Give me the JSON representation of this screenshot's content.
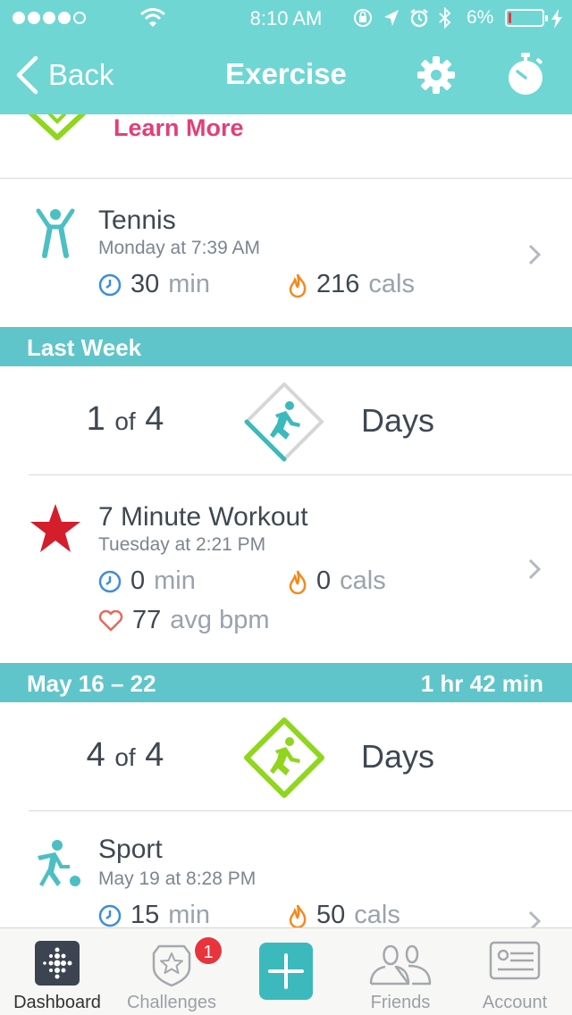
{
  "status_bar": {
    "time": "8:10 AM",
    "battery_percent": "6%",
    "battery_level": 0.06
  },
  "nav": {
    "back_label": "Back",
    "title": "Exercise"
  },
  "learn_more": {
    "link": "Learn More"
  },
  "sections": [
    {
      "items": [
        {
          "title": "Tennis",
          "subtitle": "Monday at 7:39 AM",
          "duration": "30",
          "duration_unit": "min",
          "calories": "216",
          "calories_unit": "cals"
        }
      ]
    },
    {
      "label": "Last Week",
      "summary": {
        "count": "1",
        "of": "of",
        "goal": "4",
        "unit": "Days",
        "progress": 0.25
      },
      "items": [
        {
          "title": "7 Minute Workout",
          "subtitle": "Tuesday at 2:21 PM",
          "duration": "0",
          "duration_unit": "min",
          "calories": "0",
          "calories_unit": "cals",
          "heart": "77",
          "heart_unit": "avg bpm"
        }
      ]
    },
    {
      "label": "May 16 – 22",
      "total": "1 hr 42 min",
      "summary": {
        "count": "4",
        "of": "of",
        "goal": "4",
        "unit": "Days",
        "progress": 1.0
      },
      "items": [
        {
          "title": "Sport",
          "subtitle": "May 19 at 8:28 PM",
          "duration": "15",
          "duration_unit": "min",
          "calories": "50",
          "calories_unit": "cals"
        }
      ]
    }
  ],
  "tabbar": {
    "tabs": [
      {
        "label": "Dashboard",
        "icon": "fitbit-dots-icon",
        "active": true
      },
      {
        "label": "Challenges",
        "icon": "challenge-badge-icon",
        "badge": "1"
      },
      {
        "label": "",
        "icon": "plus-icon"
      },
      {
        "label": "Friends",
        "icon": "friends-icon"
      },
      {
        "label": "Account",
        "icon": "id-card-icon"
      }
    ]
  },
  "colors": {
    "header": "#6fd6d3",
    "section": "#5fc5ca",
    "accent_teal": "#3cb9bc",
    "learn_more": "#e23f79",
    "goal_met": "#8fd61d",
    "flame": "#f28a1e",
    "clock": "#3a8de0",
    "heart": "#e8685a",
    "star": "#d41e2c"
  }
}
